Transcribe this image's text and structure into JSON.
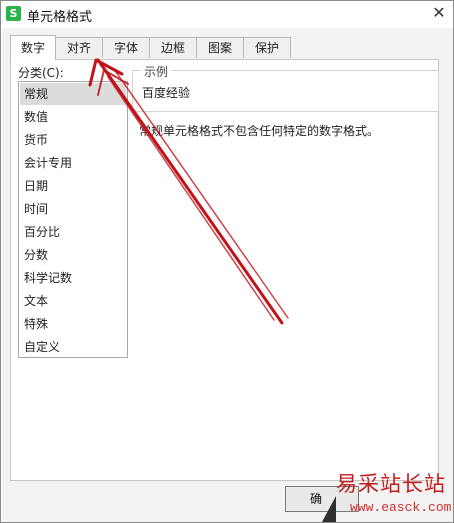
{
  "window": {
    "title": "单元格格式",
    "app_icon": "S",
    "close_glyph": "✕"
  },
  "tabs": [
    {
      "label": "数字",
      "active": true
    },
    {
      "label": "对齐",
      "active": false
    },
    {
      "label": "字体",
      "active": false
    },
    {
      "label": "边框",
      "active": false
    },
    {
      "label": "图案",
      "active": false
    },
    {
      "label": "保护",
      "active": false
    }
  ],
  "category": {
    "label": "分类(C):",
    "items": [
      "常规",
      "数值",
      "货币",
      "会计专用",
      "日期",
      "时间",
      "百分比",
      "分数",
      "科学记数",
      "文本",
      "特殊",
      "自定义"
    ],
    "selected": "常规"
  },
  "sample": {
    "group_title": "示例",
    "value": "百度经验"
  },
  "description": "常规单元格格式不包含任何特定的数字格式。",
  "buttons": {
    "ok_label": "确"
  },
  "watermark": {
    "text": "易采站长站",
    "url": "www.easck.com"
  },
  "colors": {
    "arrow": "#c0141a",
    "app_icon": "#2bb24c",
    "watermark": "#c21e1e"
  },
  "icons": {
    "app": "wps-spreadsheet-icon",
    "close": "close-icon"
  }
}
